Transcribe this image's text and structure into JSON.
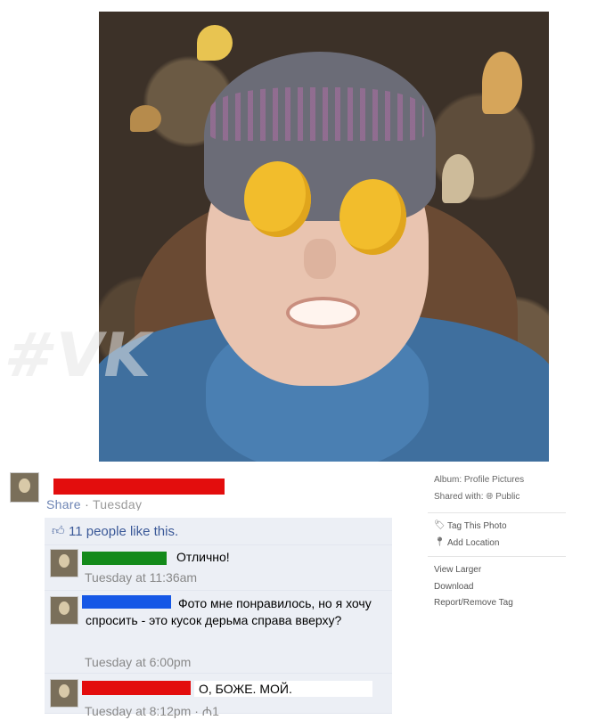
{
  "post": {
    "share_line": {
      "share": "Share",
      "separator": "·",
      "time": "Tuesday"
    },
    "likes_text": "11 people like this."
  },
  "comments": [
    {
      "text": "Отлично!",
      "time": "Tuesday at 11:36am",
      "redaction_color": "#138a1a"
    },
    {
      "text": "Фото мне понравилось, но я хочу спросить - это кусок дерьма справа вверху?",
      "time": "Tuesday at 6:00pm",
      "redaction_color": "#1557e6"
    },
    {
      "text": "О, БОЖЕ. МОЙ.",
      "time": "Tuesday at 8:12pm · ₼1",
      "redaction_color": "#e30d0d"
    }
  ],
  "sidebar": {
    "album_label": "Album:",
    "album_value": "Profile Pictures",
    "shared_label": "Shared with:",
    "shared_value": "Public",
    "tag_photo": "Tag This Photo",
    "add_location": "Add Location",
    "view_larger": "View Larger",
    "download": "Download",
    "report_tag": "Report/Remove Tag"
  },
  "watermark": "#VK",
  "icons": [
    "like-icon",
    "globe-icon",
    "tag-icon",
    "location-pin-icon"
  ],
  "colors": {
    "redaction_red": "#e30d0d",
    "link_blue": "#3b5998",
    "comment_bg": "#eceff5"
  }
}
